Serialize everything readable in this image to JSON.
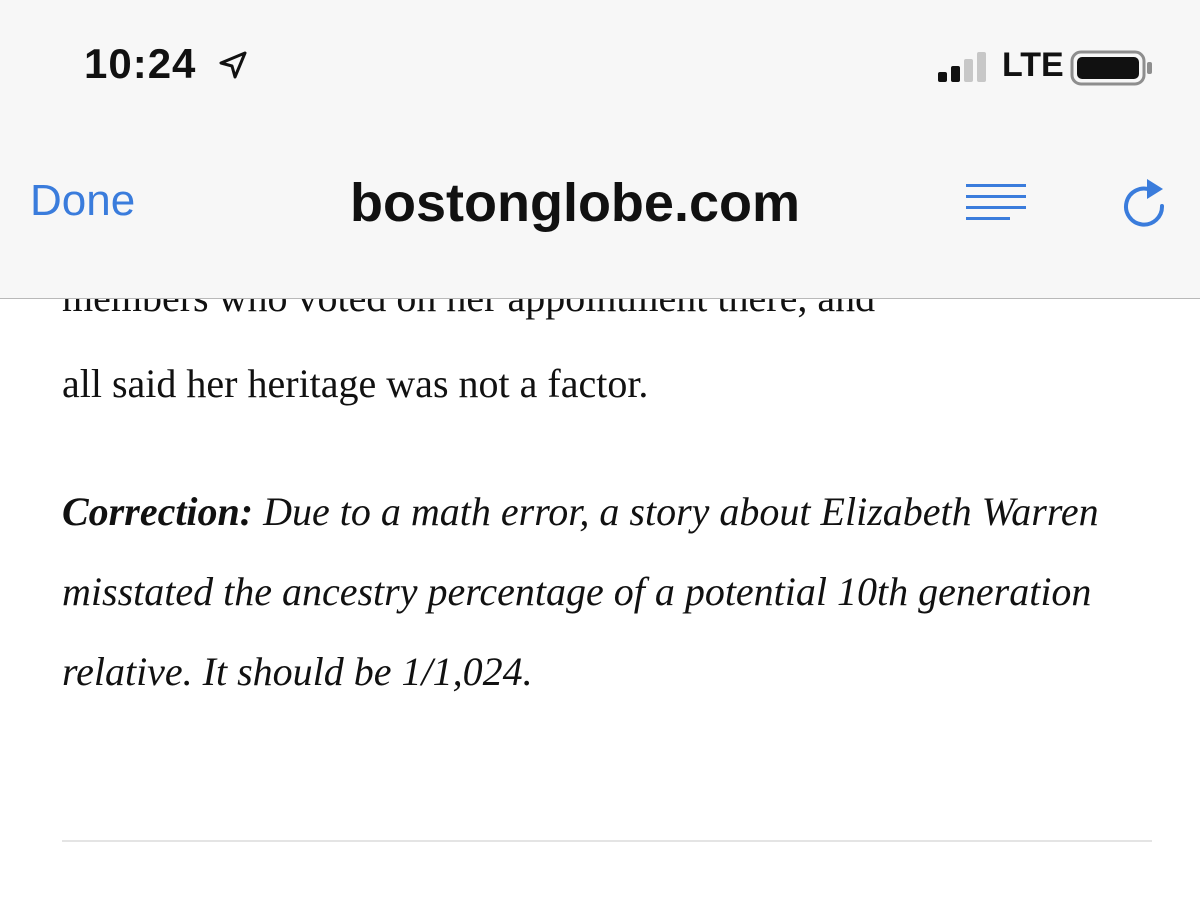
{
  "status_bar": {
    "time": "10:24",
    "network": "LTE",
    "icons": [
      "location-arrow-icon",
      "signal-bars-icon",
      "battery-icon"
    ]
  },
  "nav": {
    "done_label": "Done",
    "domain": "bostonglobe.com",
    "icons": [
      "reader-view-icon",
      "reload-icon"
    ],
    "accent_color": "#3a7cdc"
  },
  "article": {
    "cutoff_line": "members who voted on her appointment there, and",
    "paragraph_end": "all said her heritage was not a factor.",
    "correction_label": "Correction:",
    "correction_text": " Due to a math error, a story about Elizabeth Warren misstated the ancestry percentage of a potential 10th generation relative. It should be 1/1,024."
  }
}
